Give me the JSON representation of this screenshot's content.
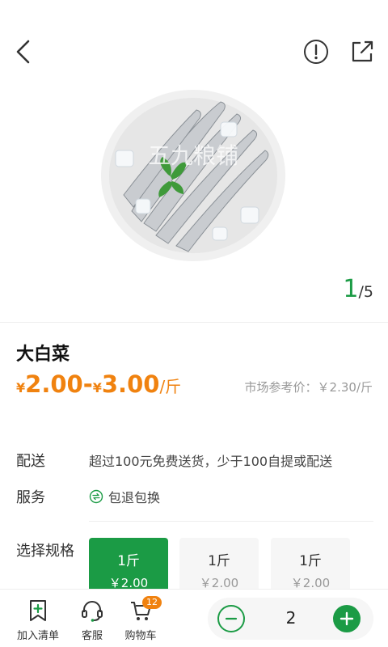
{
  "header": {
    "back_icon": "chevron-left-icon",
    "info_icon": "info-circle-icon",
    "share_icon": "share-external-icon"
  },
  "gallery": {
    "watermark": "五九粮铺",
    "current": "1",
    "total": "/5"
  },
  "product": {
    "name": "大白菜",
    "price_low_currency": "¥",
    "price_low": "2.00-",
    "price_high_currency": "¥",
    "price_high": "3.00",
    "price_unit": "/斤",
    "market_price": "市场参考价：￥2.30/斤"
  },
  "details": {
    "delivery_label": "配送",
    "delivery_text": "超过100元免费送货，少于100自提或配送",
    "service_label": "服务",
    "service_text": "包退包换",
    "spec_label": "选择规格",
    "specs": [
      {
        "weight": "1斤",
        "price": "￥2.00",
        "selected": true
      },
      {
        "weight": "1斤",
        "price": "￥2.00",
        "selected": false
      },
      {
        "weight": "1斤",
        "price": "￥2.00",
        "selected": false
      }
    ]
  },
  "bottom": {
    "add_list": "加入清单",
    "service": "客服",
    "cart": "购物车",
    "cart_badge": "12",
    "quantity": "2"
  },
  "colors": {
    "accent_green": "#1b9b45",
    "price_orange": "#f0820f"
  }
}
